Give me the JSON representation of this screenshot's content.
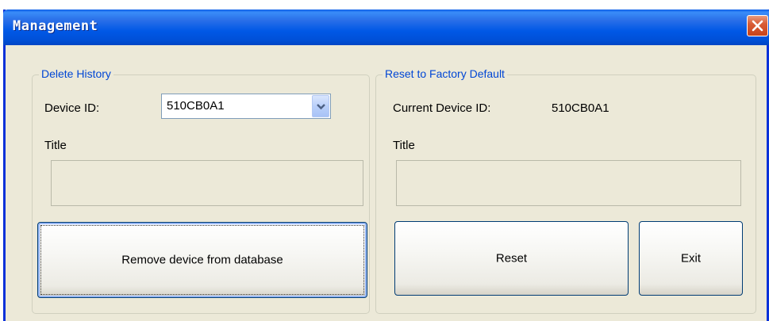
{
  "window": {
    "title": "Management"
  },
  "delete_history": {
    "legend": "Delete History",
    "device_id_label": "Device ID:",
    "device_id_value": "510CB0A1",
    "title_label": "Title",
    "title_value": "",
    "remove_button": "Remove device from database"
  },
  "reset_factory": {
    "legend": "Reset to Factory Default",
    "current_device_label": "Current Device ID:",
    "current_device_value": "510CB0A1",
    "title_label": "Title",
    "title_value": "",
    "reset_button": "Reset"
  },
  "exit_button": "Exit",
  "icons": {
    "close": "close-icon",
    "dropdown": "chevron-down-icon"
  },
  "colors": {
    "titlebar": "#0058e6",
    "legend_text": "#0046d5",
    "close_button": "#d95d36",
    "dialog_bg": "#ece9d8"
  }
}
